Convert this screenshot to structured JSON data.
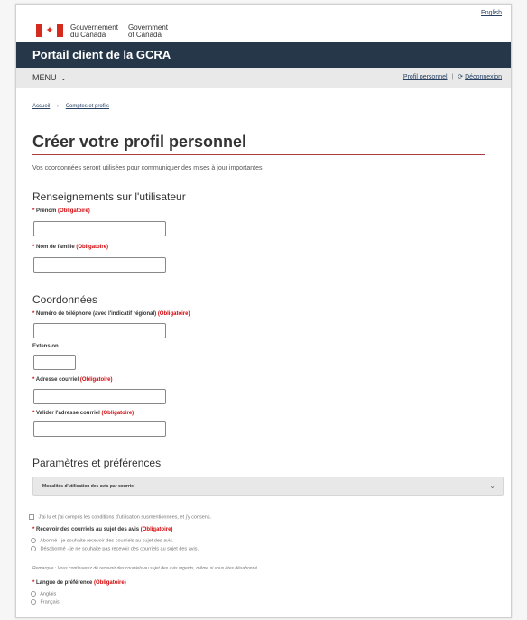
{
  "gov_header": {
    "signature_fr_line1": "Gouvernement",
    "signature_fr_line2": "du Canada",
    "signature_en_line1": "Government",
    "signature_en_line2": "of Canada",
    "language_toggle": "English"
  },
  "app_header": {
    "title": "Portail client de la GCRA"
  },
  "menu_bar": {
    "menu_label": "MENU",
    "profile_link": "Profil personnel",
    "logout_link": "Déconnexion"
  },
  "breadcrumb": {
    "home": "Accueil",
    "current": "Comptes et profils"
  },
  "page": {
    "title": "Créer votre profil personnel",
    "intro": "Vos coordonnées seront utilisées pour communiquer des mises à jour importantes."
  },
  "sections": {
    "user_info": "Renseignements sur l'utilisateur",
    "contact": "Coordonnées",
    "settings": "Paramètres et préférences"
  },
  "required_marker": "*",
  "required_text": "(Obligatoire)",
  "fields": {
    "first_name": "Prénom",
    "last_name": "Nom de famille",
    "phone": "Numéro de téléphone (avec l'indicatif régional)",
    "extension": "Extension",
    "email": "Adresse courriel",
    "email_confirm": "Valider l'adresse courriel"
  },
  "settings": {
    "accordion_label": "Modalités d'utilisation des avis par courriel",
    "consent_text": "J'ai lu et j'ai compris les conditions d'utilisation susmentionnées, et j'y consens.",
    "notifications_label": "Recevoir des courriels au sujet des avis",
    "subscribe_option": "Abonné - je souhaite recevoir des courriels au sujet des avis.",
    "unsubscribe_option": "Désabonné - je ne souhaite pas recevoir des courriels au sujet des avis.",
    "note": "Remarque : Vous continuerez de recevoir des courriels au sujet des avis urgents, même si vous êtes désabonné.",
    "language_label": "Langue de préférence",
    "language_options": [
      "Anglais",
      "Français"
    ]
  }
}
